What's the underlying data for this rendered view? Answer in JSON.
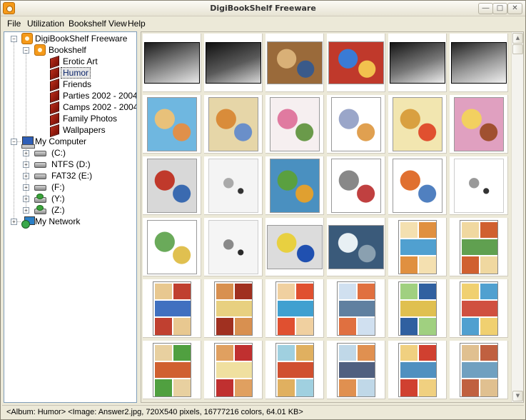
{
  "window": {
    "title": "DigiBookShelf Freeware",
    "buttons": [
      "minimize",
      "maximize",
      "close"
    ]
  },
  "menu": [
    "File",
    "Utilization",
    "Bookshelf View",
    "Help"
  ],
  "tree": {
    "root": "DigiBookShelf Freeware",
    "bookshelf": "Bookshelf",
    "albums": [
      "Erotic Art",
      "Humor",
      "Friends",
      "Parties 2002 - 2004",
      "Camps 2002 - 2004",
      "Family Photos",
      "Wallpapers"
    ],
    "selected_album": "Humor",
    "my_computer": "My Computer",
    "drives": [
      {
        "label": "(C:)",
        "icon": "drive-icon"
      },
      {
        "label": "NTFS (D:)",
        "icon": "drive-icon"
      },
      {
        "label": "FAT32 (E:)",
        "icon": "drive-icon"
      },
      {
        "label": "(F:)",
        "icon": "drive-icon"
      },
      {
        "label": "(Y:)",
        "icon": "network-drive-icon"
      },
      {
        "label": "(Z:)",
        "icon": "network-drive-icon"
      }
    ],
    "my_network": "My Network"
  },
  "thumbnails": [
    {
      "kind": "photo-bw",
      "colors": [
        "#1a1a1a",
        "#8a8a8a",
        "#e8e8e8"
      ]
    },
    {
      "kind": "photo-bw",
      "colors": [
        "#111111",
        "#5a5a5a",
        "#d8d8d8"
      ]
    },
    {
      "kind": "cartoon",
      "colors": [
        "#9a6a3a",
        "#d9b077",
        "#3a5a8a"
      ]
    },
    {
      "kind": "cartoon",
      "colors": [
        "#c0392b",
        "#3a7bd5",
        "#f2c14e"
      ]
    },
    {
      "kind": "photo-bw",
      "colors": [
        "#151515",
        "#777777",
        "#eeeeee"
      ]
    },
    {
      "kind": "photo-bw",
      "colors": [
        "#222222",
        "#9a9a9a",
        "#f0f0f0"
      ]
    },
    {
      "kind": "cartoon",
      "colors": [
        "#6fb7e0",
        "#e8c17a",
        "#e0904a"
      ]
    },
    {
      "kind": "cartoon",
      "colors": [
        "#e6d6a8",
        "#d98c3a",
        "#6a8fc9"
      ]
    },
    {
      "kind": "diagram",
      "colors": [
        "#f6eff0",
        "#e07aa0",
        "#6a9a4a"
      ]
    },
    {
      "kind": "cartoon",
      "colors": [
        "#ffffff",
        "#9aa6c9",
        "#e0a050"
      ]
    },
    {
      "kind": "cartoon",
      "colors": [
        "#f2e6b0",
        "#d9a040",
        "#e05030"
      ]
    },
    {
      "kind": "cartoon",
      "colors": [
        "#e0a0c0",
        "#f2d060",
        "#a05030"
      ]
    },
    {
      "kind": "cartoon",
      "colors": [
        "#d8d8d8",
        "#c0392b",
        "#3a6ab0"
      ]
    },
    {
      "kind": "sketch",
      "colors": [
        "#f4f4f4",
        "#aaaaaa",
        "#333333"
      ]
    },
    {
      "kind": "cartoon",
      "colors": [
        "#4a90c0",
        "#5aa040",
        "#e0a030"
      ]
    },
    {
      "kind": "cartoon",
      "colors": [
        "#ffffff",
        "#888888",
        "#c04040"
      ]
    },
    {
      "kind": "cartoon",
      "colors": [
        "#ffffff",
        "#e07030",
        "#5080c0"
      ]
    },
    {
      "kind": "sketch",
      "colors": [
        "#ffffff",
        "#999999",
        "#333333"
      ]
    },
    {
      "kind": "cartoon",
      "colors": [
        "#ffffff",
        "#6aaa5a",
        "#e0c050"
      ]
    },
    {
      "kind": "sketch",
      "colors": [
        "#f5f5f5",
        "#8a8a8a",
        "#2a2a2a"
      ]
    },
    {
      "kind": "photo",
      "colors": [
        "#dcdcdc",
        "#e8d040",
        "#2050b0"
      ]
    },
    {
      "kind": "photo",
      "colors": [
        "#3a5a7a",
        "#e8f0f4",
        "#8aa0b0"
      ]
    },
    {
      "kind": "comic",
      "colors": [
        "#f4e0b0",
        "#e09040",
        "#50a0d0"
      ]
    },
    {
      "kind": "comic",
      "colors": [
        "#f0d8a0",
        "#d06030",
        "#60a050"
      ]
    },
    {
      "kind": "comic",
      "colors": [
        "#e8c890",
        "#c04030",
        "#4070c0"
      ]
    },
    {
      "kind": "comic",
      "colors": [
        "#d89050",
        "#a03020",
        "#e8d080"
      ]
    },
    {
      "kind": "comic",
      "colors": [
        "#f0d0a0",
        "#e05030",
        "#40a0d0"
      ]
    },
    {
      "kind": "comic",
      "colors": [
        "#d0e0f0",
        "#e07040",
        "#6080a0"
      ]
    },
    {
      "kind": "comic",
      "colors": [
        "#a0d080",
        "#3060a0",
        "#e0c050"
      ]
    },
    {
      "kind": "comic",
      "colors": [
        "#f0d070",
        "#50a0d0",
        "#d05040"
      ]
    },
    {
      "kind": "comic",
      "colors": [
        "#e8d0a0",
        "#50a040",
        "#d06030"
      ]
    },
    {
      "kind": "comic",
      "colors": [
        "#e0a060",
        "#c03030",
        "#f0e0a0"
      ]
    },
    {
      "kind": "comic",
      "colors": [
        "#a0d0e0",
        "#e0b060",
        "#d05030"
      ]
    },
    {
      "kind": "comic",
      "colors": [
        "#c0d8e8",
        "#e09050",
        "#506080"
      ]
    },
    {
      "kind": "comic",
      "colors": [
        "#f0d080",
        "#d04030",
        "#5090c0"
      ]
    },
    {
      "kind": "comic",
      "colors": [
        "#e0c090",
        "#c06040",
        "#70a0c0"
      ]
    }
  ],
  "status": "<Album: Humor> <Image: Answer2.jpg, 720X540 pixels, 16777216 colors, 64.01 KB>"
}
